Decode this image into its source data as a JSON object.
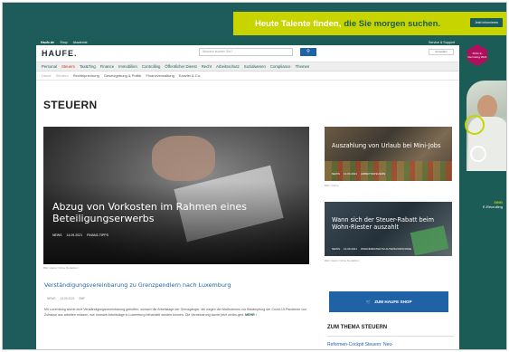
{
  "top_ad": {
    "text": "Heute Talente finden,",
    "highlight": "die Sie morgen suchen.",
    "button": "Jetzt informieren"
  },
  "side_ad": {
    "badge": "XING E-Recruiting 2021",
    "xing": "XING",
    "xing_sub": "E-Recruiting"
  },
  "utility": {
    "links": [
      "Haufe.de",
      "Shop",
      "Akademie"
    ],
    "right": "Service & Support"
  },
  "header": {
    "logo": "HAUFE.",
    "search_placeholder": "Wonach suchen Sie?",
    "account": "Anmelden"
  },
  "nav": {
    "categories": [
      "Personal",
      "Steuern",
      "Tax&Ting",
      "Finance",
      "Immobilien",
      "Controlling",
      "Öffentlicher Dienst",
      "Recht",
      "Arbeitsschutz",
      "Sozialwesen",
      "Compliance",
      "Themen"
    ],
    "sub": [
      "Haufe",
      "Steuern",
      "Rechtsprechung",
      "Gesetzgebung & Politik",
      "Finanzverwaltung",
      "Kanzlei & Co."
    ]
  },
  "page": {
    "title": "STEUERN"
  },
  "hero": {
    "title": "Abzug von Vorkosten im Rahmen eines Beteiligungserwerbs",
    "tag": "NEWS",
    "date": "14.09.2021",
    "source": "FINANZ-TIPPS",
    "caption": "Bild: Haufe Online Redaktion"
  },
  "teasers": [
    {
      "title": "Auszahlung von Urlaub bei Mini-Jobs",
      "tag": "NEWS",
      "date": "13.09.2021",
      "source": "ARBEITSSTEUERN",
      "caption": "Bild: Corbis"
    },
    {
      "title": "Wann sich der Steuer-Rabatt beim Wohn-Riester auszahlt",
      "tag": "NEWS",
      "date": "13.09.2021",
      "source": "WOHNRIESTER IM ALTERSVORSORGE",
      "caption": "Bild: Haufe Online Redaktion"
    }
  ],
  "article": {
    "title": "Verständigungsvereinbarung zu Grenzpendlern nach Luxemburg",
    "tag": "NEWS",
    "date": "13.09.2021",
    "source": "BMF",
    "text": "Mit Luxemburg wurde eine Verständigungsvereinbarung getroffen, wonach die Arbeitstage der Grenzgänger, die wegen der Maßnahmen zur Bekämpfung der Covid-19-Pandemie von Zuhause aus arbeiten müssen, wie normale Arbeitstage in Luxemburg behandelt werden können. Die Vereinbarung wurde jetzt verlän-gert.",
    "more": "MEHR"
  },
  "shop": {
    "label": "ZUM HAUFE SHOP"
  },
  "thema": {
    "title": "ZUM THEMA STEUERN",
    "link": "Reformen-Cockpit Steuern: Neu-"
  }
}
